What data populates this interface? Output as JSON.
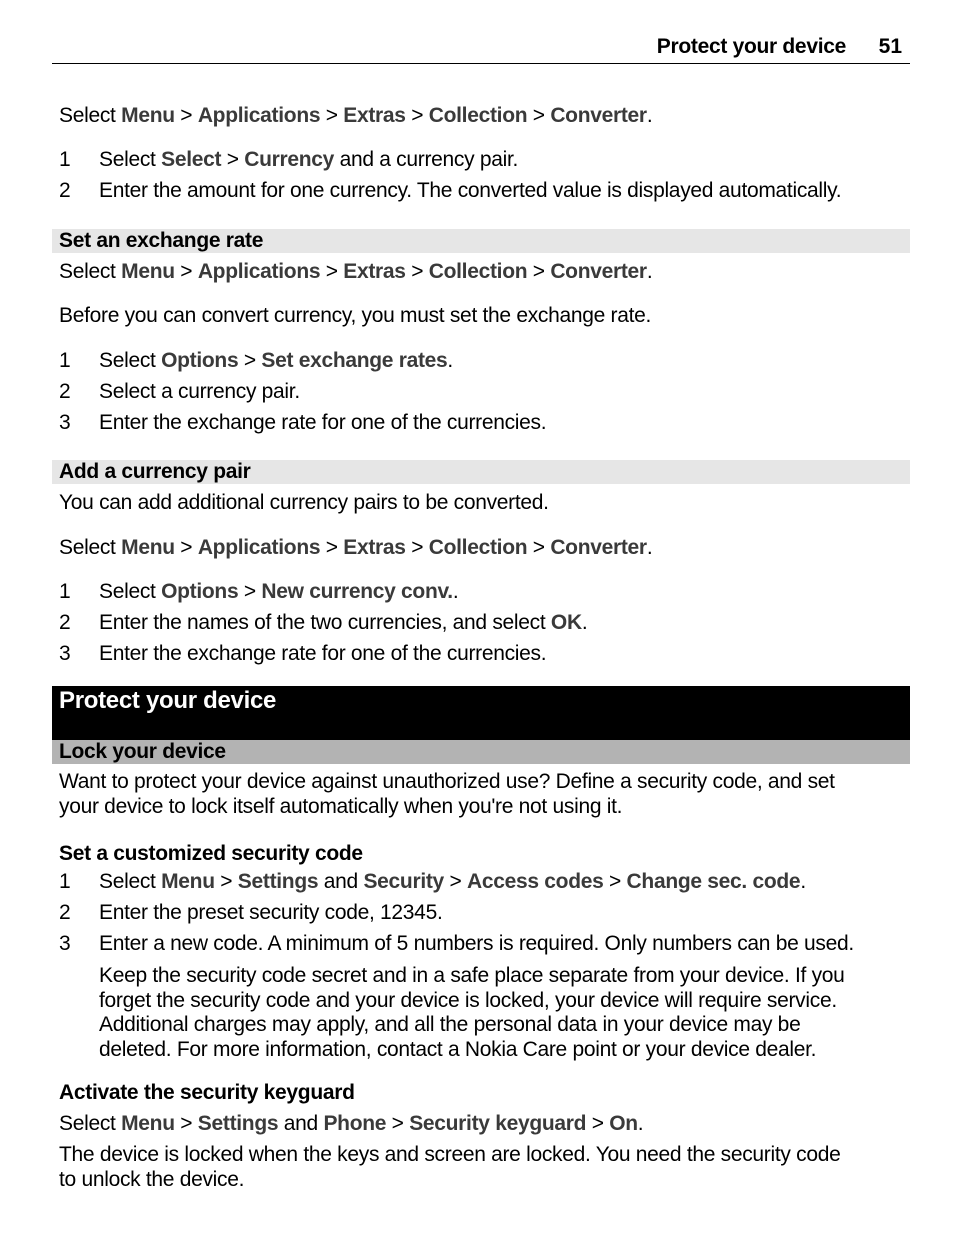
{
  "header": {
    "title": "Protect your device",
    "page_number": "51"
  },
  "converter_intro": {
    "path": {
      "select": "Select",
      "items": [
        "Menu",
        "Applications",
        "Extras",
        "Collection",
        "Converter"
      ]
    },
    "steps": [
      {
        "n": "1",
        "pre": "Select ",
        "b1": "Select",
        "sep": " > ",
        "b2": "Currency",
        "post": " and a currency pair."
      },
      {
        "n": "2",
        "text": "Enter the amount for one currency. The converted value is displayed automatically."
      }
    ]
  },
  "exchange_rate": {
    "heading": "Set an exchange rate",
    "path": {
      "select": "Select",
      "items": [
        "Menu",
        "Applications",
        "Extras",
        "Collection",
        "Converter"
      ]
    },
    "intro": "Before you can convert currency, you must set the exchange rate.",
    "steps": [
      {
        "n": "1",
        "pre": "Select ",
        "b1": "Options",
        "sep": " > ",
        "b2": "Set exchange rates",
        "post": "."
      },
      {
        "n": "2",
        "text": "Select a currency pair."
      },
      {
        "n": "3",
        "text": "Enter the exchange rate for one of the currencies."
      }
    ]
  },
  "currency_pair": {
    "heading": "Add a currency pair",
    "intro": "You can add additional currency pairs to be converted.",
    "path": {
      "select": "Select",
      "items": [
        "Menu",
        "Applications",
        "Extras",
        "Collection",
        "Converter"
      ]
    },
    "steps": [
      {
        "n": "1",
        "pre": "Select ",
        "b1": "Options",
        "sep": " > ",
        "b2": "New currency conv.",
        "post": "."
      },
      {
        "n": "2",
        "pre": "Enter the names of the two currencies, and select ",
        "b1": "OK",
        "post": "."
      },
      {
        "n": "3",
        "text": "Enter the exchange rate for one of the currencies."
      }
    ]
  },
  "chapter": {
    "title": "Protect your device"
  },
  "lock": {
    "heading": "Lock your device",
    "intro_1": "Want to protect your device against unauthorized use? Define a security code, and set",
    "intro_2": "your device to lock itself automatically when you're not using it.",
    "sub1": "Set a customized security code",
    "step1": {
      "n": "1",
      "pre": "Select ",
      "b1": "Menu",
      "s1": " > ",
      "b2": "Settings",
      "and": " and ",
      "b3": "Security",
      "s2": " > ",
      "b4": "Access codes",
      "s3": " > ",
      "b5": "Change sec. code",
      "post": "."
    },
    "step2": {
      "n": "2",
      "text": "Enter the preset security code, 12345."
    },
    "step3": {
      "n": "3",
      "text": "Enter a new code. A minimum of 5 numbers is required. Only numbers can be used."
    },
    "note": [
      "Keep the security code secret and in a safe place separate from your device. If you",
      "forget the security code and your device is locked, your device will require service.",
      "Additional charges may apply, and all the personal data in your device may be",
      "deleted. For more information, contact a Nokia Care point or your device dealer."
    ],
    "sub2": "Activate the security keyguard",
    "keyguard": {
      "pre": "Select ",
      "b1": "Menu",
      "s1": " > ",
      "b2": "Settings",
      "and": " and ",
      "b3": "Phone",
      "s2": " > ",
      "b4": "Security keyguard",
      "s3": " > ",
      "b5": "On",
      "post": "."
    },
    "outro_1": "The device is locked when the keys and screen are locked. You need the security code",
    "outro_2": "to unlock the device."
  }
}
